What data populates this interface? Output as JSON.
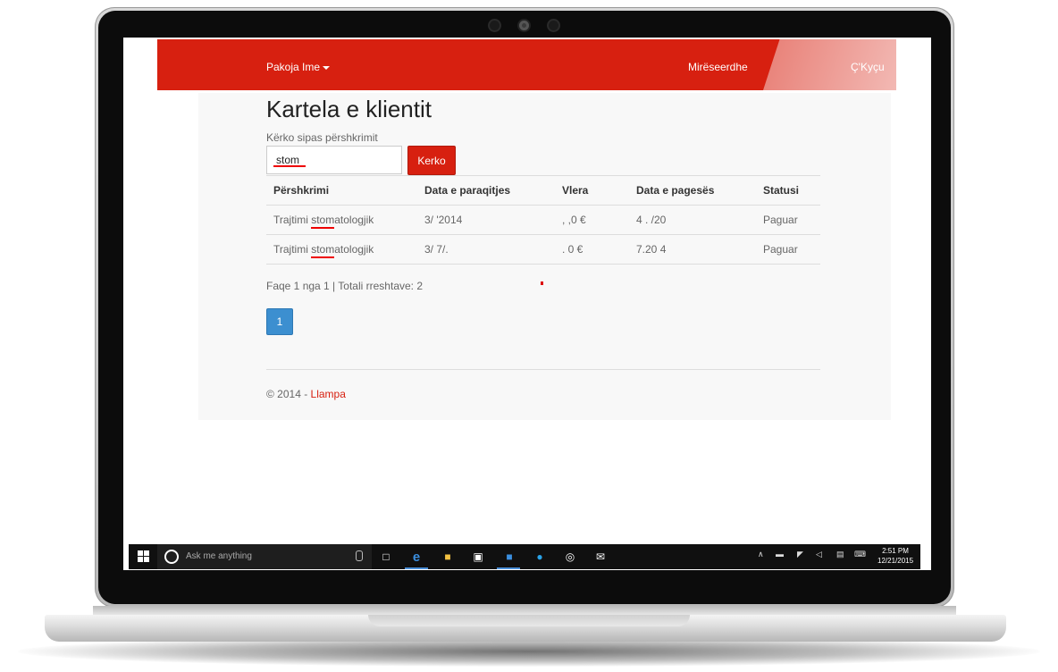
{
  "app": {
    "brand_label": "Pakoja Ime",
    "welcome_text": "Mirëseerdhe",
    "logout_label": "Ç'Kyçu"
  },
  "page": {
    "title": "Kartela e klientit",
    "search_label": "Kërko sipas përshkrimit",
    "search_value": "stom",
    "search_button": "Kerko"
  },
  "table": {
    "headers": [
      "Përshkrimi",
      "Data e paraqitjes",
      "Vlera",
      "Data e pagesës",
      "Statusi"
    ],
    "rows": [
      {
        "prefix": "Trajtimi ",
        "highlight": "stom",
        "suffix": "atologjik",
        "date_submitted": "3/ '2014",
        "value": ", ,0 €",
        "date_paid": "4 . /20",
        "status": "Paguar"
      },
      {
        "prefix": "Trajtimi ",
        "highlight": "stom",
        "suffix": "atologjik",
        "date_submitted": "3/ 7/.",
        "value": ". 0 €",
        "date_paid": "7.20 4",
        "status": "Paguar"
      }
    ]
  },
  "pagination": {
    "info": "Faqe 1 nga 1 | Totali rreshtave: 2",
    "current_page": "1"
  },
  "footer": {
    "copyright": "© 2014 - ",
    "link_text": "Llampa"
  },
  "taskbar": {
    "search_placeholder": "Ask me anything",
    "time": "2:51 PM",
    "date": "12/21/2015"
  },
  "colors": {
    "brand_red": "#d72010",
    "pager_blue": "#3c8fd0",
    "taskbar": "#101010"
  }
}
